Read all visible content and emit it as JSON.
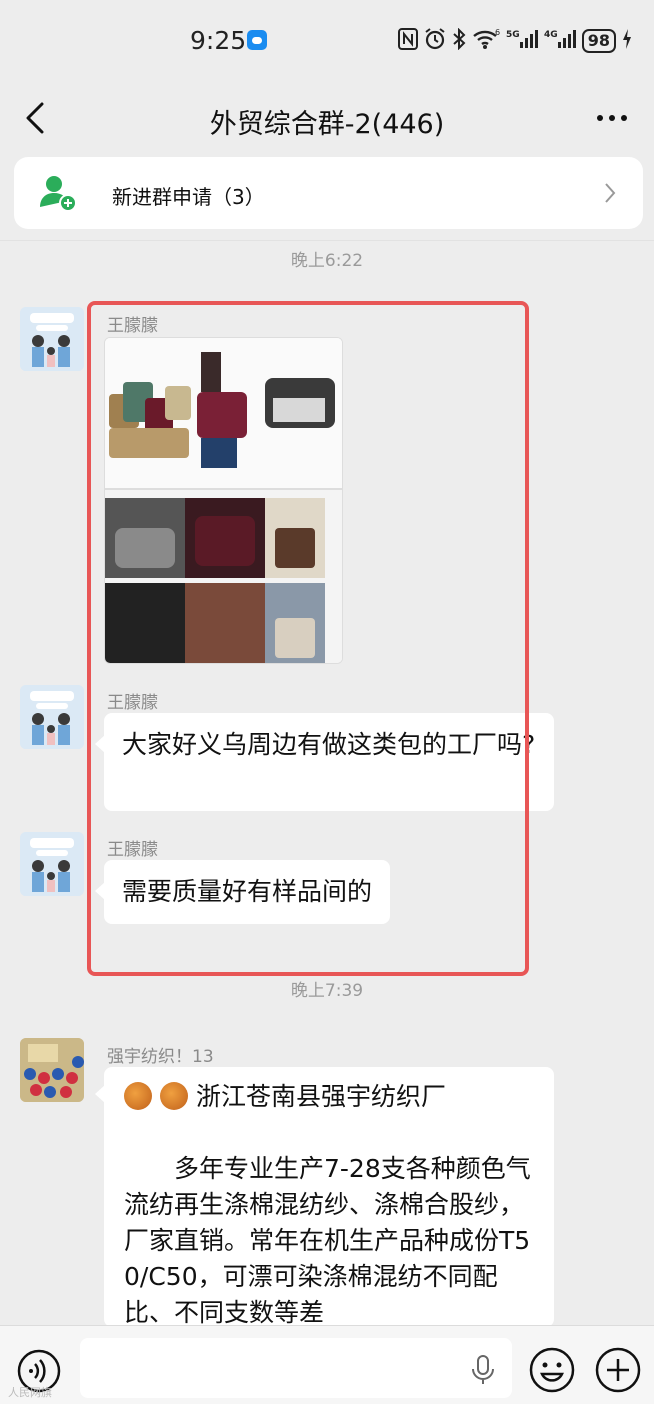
{
  "status_bar": {
    "time": "9:25",
    "network_5g": "5G",
    "network_4g": "4G",
    "battery": "98",
    "wifi_sup": "6"
  },
  "header": {
    "title": "外贸综合群-2(446)"
  },
  "join_requests": {
    "label": "新进群申请（3）"
  },
  "messages": {
    "time1": "晚上6:22",
    "time2": "晚上7:39",
    "msg1_sender": "王朦朦",
    "msg2_sender": "王朦朦",
    "msg2_text": "大家好义乌周边有做这类包的工厂吗?",
    "msg3_sender": "王朦朦",
    "msg3_text": "需要质量好有样品间的",
    "msg4_sender": "强宇纺织！13",
    "msg4_title": "浙江苍南县强宇纺织厂",
    "msg4_body": "多年专业生产7-28支各种颜色气流纺再生涤棉混纺纱、涤棉合股纱，厂家直销。常年在机生产品种成份T50/C50，可漂可染涤棉混纺不同配比、不同支数等差"
  },
  "colors": {
    "highlight": "#e85656",
    "background": "#ededed",
    "join_icon": "#2bad5a"
  },
  "watermark": "人民网旗"
}
